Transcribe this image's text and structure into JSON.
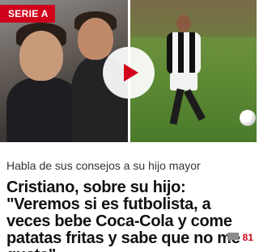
{
  "article": {
    "section": "SERIE A",
    "subtitle": "Habla de sus consejos a su hijo mayor",
    "headline": "Cristiano, sobre su hijo: \"Veremos si es futbolista, a veces bebe Coca-Cola y come patatas fritas y sabe que no me gusta\"",
    "comment_count": "81"
  },
  "media": {
    "play_icon": "play-icon",
    "comment_icon": "speech-bubble-icon"
  },
  "colors": {
    "accent": "#d0021b",
    "headline": "#111111",
    "subtitle": "#333333",
    "comment_icon": "#8c8c8c"
  }
}
